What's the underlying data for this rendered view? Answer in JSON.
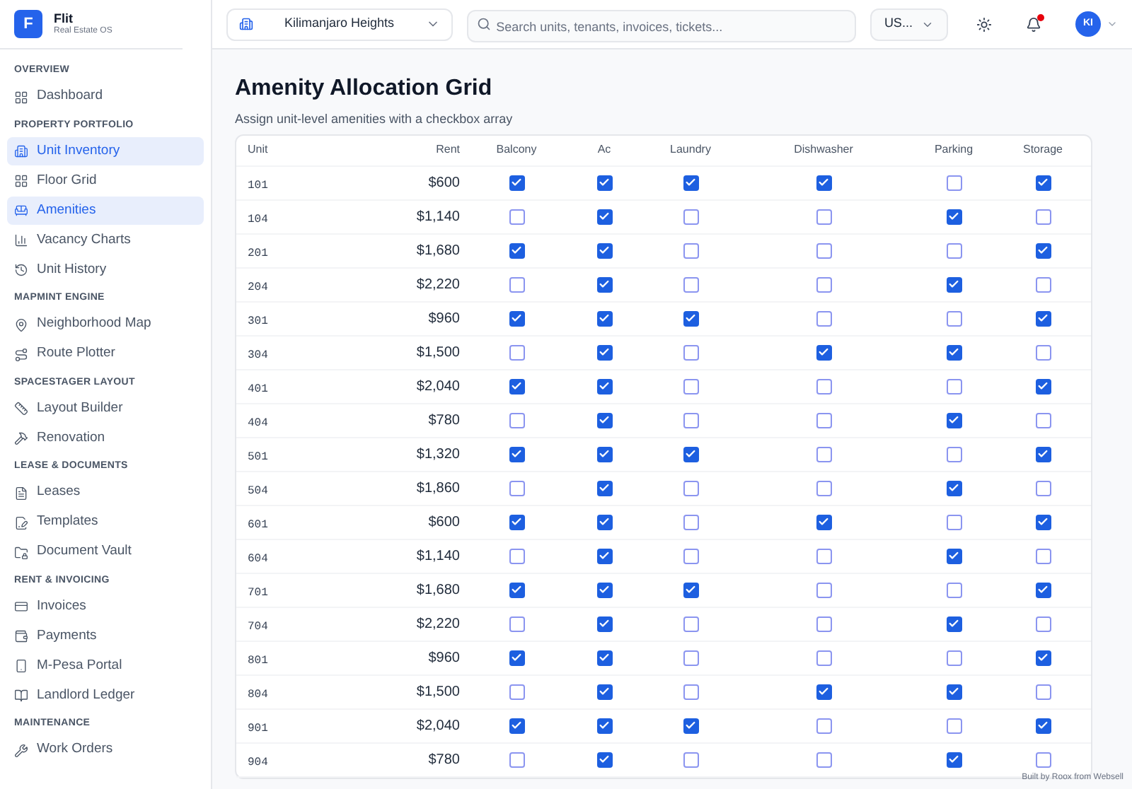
{
  "brand": {
    "logo": "F",
    "name": "Flit",
    "tagline": "Real Estate OS"
  },
  "sidebar": {
    "sections": [
      {
        "title": "OVERVIEW",
        "items": [
          {
            "label": "Dashboard",
            "selected": false
          }
        ]
      },
      {
        "title": "PROPERTY PORTFOLIO",
        "items": [
          {
            "label": "Unit Inventory",
            "selected": true
          },
          {
            "label": "Floor Grid",
            "selected": false
          },
          {
            "label": "Amenities",
            "selected": true
          },
          {
            "label": "Vacancy Charts",
            "selected": false
          },
          {
            "label": "Unit History",
            "selected": false
          }
        ]
      },
      {
        "title": "MAPMINT ENGINE",
        "items": [
          {
            "label": "Neighborhood Map",
            "selected": false
          },
          {
            "label": "Route Plotter",
            "selected": false
          }
        ]
      },
      {
        "title": "SPACESTAGER LAYOUT",
        "items": [
          {
            "label": "Layout Builder",
            "selected": false
          },
          {
            "label": "Renovation",
            "selected": false
          }
        ]
      },
      {
        "title": "LEASE & DOCUMENTS",
        "items": [
          {
            "label": "Leases",
            "selected": false
          },
          {
            "label": "Templates",
            "selected": false
          },
          {
            "label": "Document Vault",
            "selected": false
          }
        ]
      },
      {
        "title": "RENT & INVOICING",
        "items": [
          {
            "label": "Invoices",
            "selected": false
          },
          {
            "label": "Payments",
            "selected": false
          },
          {
            "label": "M-Pesa Portal",
            "selected": false
          },
          {
            "label": "Landlord Ledger",
            "selected": false
          }
        ]
      },
      {
        "title": "MAINTENANCE",
        "items": [
          {
            "label": "Work Orders",
            "selected": false
          }
        ]
      }
    ]
  },
  "topbar": {
    "property": "Kilimanjaro Heights",
    "search": {
      "placeholder": "Search units, tenants, invoices, tickets..."
    },
    "currency": "US...",
    "avatar": "KI",
    "notification": true
  },
  "page": {
    "title": "Amenity Allocation Grid",
    "subtitle": "Assign unit-level amenities with a checkbox array"
  },
  "table": {
    "columns": [
      "Unit",
      "Rent",
      "Balcony",
      "Ac",
      "Laundry",
      "Dishwasher",
      "Parking",
      "Storage"
    ],
    "rows": [
      {
        "unit": "101",
        "rent": "$600",
        "amenities": [
          true,
          true,
          true,
          true,
          false,
          true
        ]
      },
      {
        "unit": "104",
        "rent": "$1,140",
        "amenities": [
          false,
          true,
          false,
          false,
          true,
          false
        ]
      },
      {
        "unit": "201",
        "rent": "$1,680",
        "amenities": [
          true,
          true,
          false,
          false,
          false,
          true
        ]
      },
      {
        "unit": "204",
        "rent": "$2,220",
        "amenities": [
          false,
          true,
          false,
          false,
          true,
          false
        ]
      },
      {
        "unit": "301",
        "rent": "$960",
        "amenities": [
          true,
          true,
          true,
          false,
          false,
          true
        ]
      },
      {
        "unit": "304",
        "rent": "$1,500",
        "amenities": [
          false,
          true,
          false,
          true,
          true,
          false
        ]
      },
      {
        "unit": "401",
        "rent": "$2,040",
        "amenities": [
          true,
          true,
          false,
          false,
          false,
          true
        ]
      },
      {
        "unit": "404",
        "rent": "$780",
        "amenities": [
          false,
          true,
          false,
          false,
          true,
          false
        ]
      },
      {
        "unit": "501",
        "rent": "$1,320",
        "amenities": [
          true,
          true,
          true,
          false,
          false,
          true
        ]
      },
      {
        "unit": "504",
        "rent": "$1,860",
        "amenities": [
          false,
          true,
          false,
          false,
          true,
          false
        ]
      },
      {
        "unit": "601",
        "rent": "$600",
        "amenities": [
          true,
          true,
          false,
          true,
          false,
          true
        ]
      },
      {
        "unit": "604",
        "rent": "$1,140",
        "amenities": [
          false,
          true,
          false,
          false,
          true,
          false
        ]
      },
      {
        "unit": "701",
        "rent": "$1,680",
        "amenities": [
          true,
          true,
          true,
          false,
          false,
          true
        ]
      },
      {
        "unit": "704",
        "rent": "$2,220",
        "amenities": [
          false,
          true,
          false,
          false,
          true,
          false
        ]
      },
      {
        "unit": "801",
        "rent": "$960",
        "amenities": [
          true,
          true,
          false,
          false,
          false,
          true
        ]
      },
      {
        "unit": "804",
        "rent": "$1,500",
        "amenities": [
          false,
          true,
          false,
          true,
          true,
          false
        ]
      },
      {
        "unit": "901",
        "rent": "$2,040",
        "amenities": [
          true,
          true,
          true,
          false,
          false,
          true
        ]
      },
      {
        "unit": "904",
        "rent": "$780",
        "amenities": [
          false,
          true,
          false,
          false,
          true,
          false
        ]
      }
    ]
  },
  "footer_badge": "Built by Roox from Websell"
}
